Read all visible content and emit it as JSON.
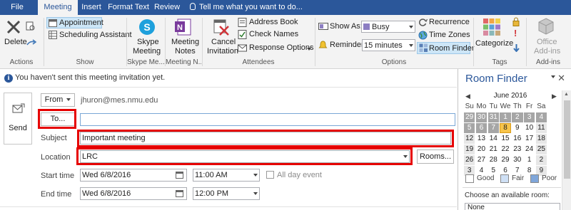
{
  "tabs": [
    {
      "label": "File"
    },
    {
      "label": "Meeting"
    },
    {
      "label": "Insert"
    },
    {
      "label": "Format Text"
    },
    {
      "label": "Review"
    }
  ],
  "tell_me": "Tell me what you want to do...",
  "ribbon": {
    "actions": {
      "delete_label": "Delete",
      "group": "Actions"
    },
    "show": {
      "appointment": "Appointment",
      "scheduling": "Scheduling Assistant",
      "group": "Show"
    },
    "skype": {
      "line1": "Skype",
      "line2": "Meeting",
      "group": "Skype Me..."
    },
    "meeting_notes": {
      "line1": "Meeting",
      "line2": "Notes",
      "group": "Meeting N..."
    },
    "attendees": {
      "cancel1": "Cancel",
      "cancel2": "Invitation",
      "address_book": "Address Book",
      "check_names": "Check Names",
      "response_options": "Response Options",
      "group": "Attendees"
    },
    "options": {
      "show_as_label": "Show As:",
      "show_as_value": "Busy",
      "reminder_label": "Reminder:",
      "reminder_value": "15 minutes",
      "recurrence": "Recurrence",
      "time_zones": "Time Zones",
      "room_finder": "Room Finder",
      "group": "Options",
      "busy_color": "#8c7ec2"
    },
    "tags": {
      "categorize": "Categorize",
      "group": "Tags"
    },
    "addins": {
      "line1": "Office",
      "line2": "Add-ins",
      "group": "Add-ins"
    }
  },
  "info_message": "You haven't sent this meeting invitation yet.",
  "form": {
    "send_label": "Send",
    "from_label": "From",
    "from_value": "jhuron@mes.nmu.edu",
    "to_label": "To...",
    "to_value": "",
    "subject_label": "Subject",
    "subject_value": "Important meeting",
    "location_label": "Location",
    "location_value": "LRC",
    "rooms_label": "Rooms...",
    "start_label": "Start time",
    "start_date": "Wed 6/8/2016",
    "start_time": "11:00 AM",
    "allday_label": "All day event",
    "end_label": "End time",
    "end_date": "Wed 6/8/2016",
    "end_time": "12:00 PM"
  },
  "room_finder": {
    "title": "Room Finder",
    "month": "June 2016",
    "day_headers": [
      "Su",
      "Mo",
      "Tu",
      "We",
      "Th",
      "Fr",
      "Sa"
    ],
    "weeks": [
      [
        {
          "d": "29",
          "s": "past"
        },
        {
          "d": "30",
          "s": "past"
        },
        {
          "d": "31",
          "s": "past"
        },
        {
          "d": "1",
          "s": "past"
        },
        {
          "d": "2",
          "s": "past"
        },
        {
          "d": "3",
          "s": "past"
        },
        {
          "d": "4",
          "s": "past"
        }
      ],
      [
        {
          "d": "5",
          "s": "past"
        },
        {
          "d": "6",
          "s": "past"
        },
        {
          "d": "7",
          "s": "past"
        },
        {
          "d": "8",
          "s": "today"
        },
        {
          "d": "9",
          "s": "good"
        },
        {
          "d": "10",
          "s": "good"
        },
        {
          "d": "11",
          "s": "fair"
        }
      ],
      [
        {
          "d": "12",
          "s": "fair"
        },
        {
          "d": "13",
          "s": "good"
        },
        {
          "d": "14",
          "s": "good"
        },
        {
          "d": "15",
          "s": "good"
        },
        {
          "d": "16",
          "s": "good"
        },
        {
          "d": "17",
          "s": "good"
        },
        {
          "d": "18",
          "s": "fair"
        }
      ],
      [
        {
          "d": "19",
          "s": "fair"
        },
        {
          "d": "20",
          "s": "good"
        },
        {
          "d": "21",
          "s": "good"
        },
        {
          "d": "22",
          "s": "good"
        },
        {
          "d": "23",
          "s": "good"
        },
        {
          "d": "24",
          "s": "good"
        },
        {
          "d": "25",
          "s": "fair"
        }
      ],
      [
        {
          "d": "26",
          "s": "fair"
        },
        {
          "d": "27",
          "s": "good"
        },
        {
          "d": "28",
          "s": "good"
        },
        {
          "d": "29",
          "s": "good"
        },
        {
          "d": "30",
          "s": "good"
        },
        {
          "d": "1",
          "s": "good"
        },
        {
          "d": "2",
          "s": "fair"
        }
      ],
      [
        {
          "d": "3",
          "s": "fair"
        },
        {
          "d": "4",
          "s": "good"
        },
        {
          "d": "5",
          "s": "good"
        },
        {
          "d": "6",
          "s": "good"
        },
        {
          "d": "7",
          "s": "good"
        },
        {
          "d": "8",
          "s": "good"
        },
        {
          "d": "9",
          "s": "fair"
        }
      ]
    ],
    "legend": {
      "good": "Good",
      "fair": "Fair",
      "poor": "Poor",
      "good_color": "#ffffff",
      "fair_color": "#cfe0f5",
      "poor_color": "#7fa6da"
    },
    "choose_label": "Choose an available room:",
    "room_value": "None"
  }
}
